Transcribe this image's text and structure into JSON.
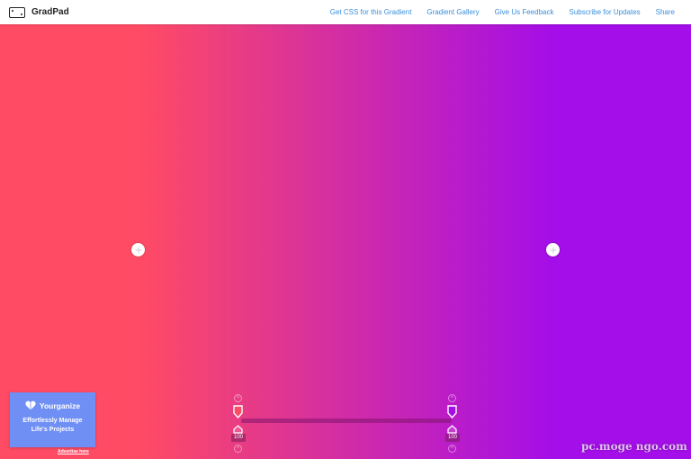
{
  "header": {
    "logo_text": "GradPad",
    "nav": [
      {
        "label": "Get CSS for this Gradient"
      },
      {
        "label": "Gradient Gallery"
      },
      {
        "label": "Give Us Feedback"
      },
      {
        "label": "Subscribe for Updates"
      },
      {
        "label": "Share"
      }
    ]
  },
  "gradient": {
    "type": "linear",
    "angle_deg": 90,
    "stops": [
      {
        "color": "#ff4b63",
        "position_percent": 20,
        "opacity": "100"
      },
      {
        "color": "#a40ee8",
        "position_percent": 80,
        "opacity": "100"
      }
    ]
  },
  "ad": {
    "brand": "Yourganize",
    "tagline_line1": "Effortlessly Manage",
    "tagline_line2": "Life's Projects",
    "link_label": "Advertise here"
  },
  "watermark": "pc.moge ngo.com"
}
